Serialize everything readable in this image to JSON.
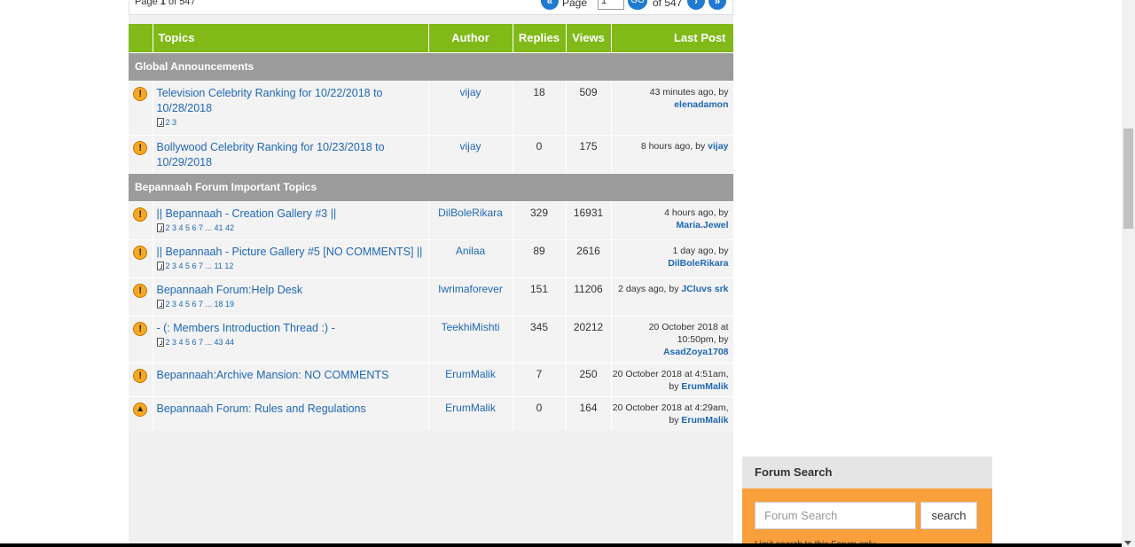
{
  "pager": {
    "page_prefix": "Page",
    "page_current": "1",
    "page_of": "of 547",
    "first_icon": "double-left-icon",
    "page_word": "Page",
    "input_value": "1",
    "go_label": "GO",
    "of_text": "of 547",
    "next_icon": "right-icon",
    "last_icon": "double-right-icon"
  },
  "table": {
    "headers": [
      "Topics",
      "Author",
      "Replies",
      "Views",
      "Last Post"
    ],
    "sections": [
      {
        "title": "Global Announcements",
        "rows": [
          {
            "icon": "warning-icon",
            "title": "Television Celebrity Ranking for 10/22/2018 to 10/28/2018",
            "pages": "2 3",
            "author": "vijay",
            "replies": "18",
            "views": "509",
            "last_prefix": "43 minutes ago, by",
            "last_by": "elenadamon"
          },
          {
            "icon": "warning-icon",
            "title": "Bollywood Celebrity Ranking for 10/23/2018 to 10/29/2018",
            "pages": "",
            "author": "vijay",
            "replies": "0",
            "views": "175",
            "last_prefix": "8 hours ago, by",
            "last_by": "vijay"
          }
        ]
      },
      {
        "title": "Bepannaah Forum Important Topics",
        "rows": [
          {
            "icon": "warning-icon",
            "title": "|| Bepannaah - Creation Gallery #3 ||",
            "pages": "2 3 4 5 6 7 ... 41 42",
            "author": "DilBoleRikara",
            "replies": "329",
            "views": "16931",
            "last_prefix": "4 hours ago, by",
            "last_by": "Maria.Jewel"
          },
          {
            "icon": "warning-icon",
            "title": "|| Bepannaah - Picture Gallery #5 [NO COMMENTS] ||",
            "pages": "2 3 4 5 6 7 ... 11 12",
            "author": "Anilaa",
            "replies": "89",
            "views": "2616",
            "last_prefix": "1 day ago, by",
            "last_by": "DilBoleRikara"
          },
          {
            "icon": "warning-icon",
            "title": "Bepannaah Forum:Help Desk",
            "pages": "2 3 4 5 6 7 ... 18 19",
            "author": "Iwrimaforever",
            "replies": "151",
            "views": "11206",
            "last_prefix": "2 days ago, by",
            "last_by": "JCluvs srk"
          },
          {
            "icon": "warning-icon",
            "title": "- (: Members Introduction Thread :) -",
            "pages": "2 3 4 5 6 7 ... 43 44",
            "author": "TeekhiMishti",
            "replies": "345",
            "views": "20212",
            "last_prefix": "20 October 2018 at 10:50pm, by",
            "last_by": "AsadZoya1708"
          },
          {
            "icon": "warning-icon",
            "title": "Bepannaah:Archive Mansion: NO COMMENTS",
            "pages": "",
            "author": "ErumMalik",
            "replies": "7",
            "views": "250",
            "last_prefix": "20 October 2018 at 4:51am, by",
            "last_by": "ErumMalik"
          },
          {
            "icon": "up-arrow-icon",
            "title": "Bepannaah Forum: Rules and Regulations",
            "pages": "",
            "author": "ErumMalik",
            "replies": "0",
            "views": "164",
            "last_prefix": "20 October 2018 at 4:29am, by",
            "last_by": "ErumMalik"
          }
        ]
      }
    ]
  },
  "forum_search": {
    "title": "Forum Search",
    "placeholder": "Forum Search",
    "button_label": "search",
    "checkbox_label": "Limit search to this Forum only"
  }
}
